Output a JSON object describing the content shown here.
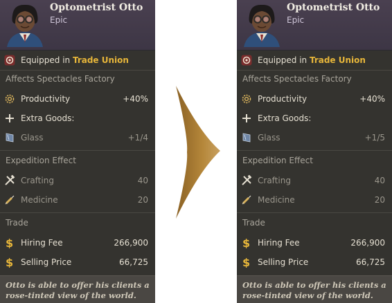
{
  "before": {
    "name": "Optometrist Otto",
    "rarity": "Epic",
    "equipped_prefix": "Equipped in ",
    "equipped_location": "Trade Union",
    "affects": "Affects Spectacles Factory",
    "productivity_label": "Productivity",
    "productivity_value": "+40%",
    "extra_goods_label": "Extra Goods:",
    "glass_label": "Glass",
    "glass_value": "+1/4",
    "expedition_header": "Expedition Effect",
    "crafting_label": "Crafting",
    "crafting_value": "40",
    "medicine_label": "Medicine",
    "medicine_value": "20",
    "trade_header": "Trade",
    "hiring_fee_label": "Hiring Fee",
    "hiring_fee_value": "266,900",
    "selling_price_label": "Selling Price",
    "selling_price_value": "66,725",
    "flavor": "Otto is able to offer his clients a rose-tinted view of the world."
  },
  "after": {
    "name": "Optometrist Otto",
    "rarity": "Epic",
    "equipped_prefix": "Equipped in ",
    "equipped_location": "Trade Union",
    "affects": "Affects Spectacles Factory",
    "productivity_label": "Productivity",
    "productivity_value": "+40%",
    "extra_goods_label": "Extra Goods:",
    "glass_label": "Glass",
    "glass_value": "+1/5",
    "expedition_header": "Expedition Effect",
    "crafting_label": "Crafting",
    "crafting_value": "40",
    "medicine_label": "Medicine",
    "medicine_value": "20",
    "trade_header": "Trade",
    "hiring_fee_label": "Hiring Fee",
    "hiring_fee_value": "266,900",
    "selling_price_label": "Selling Price",
    "selling_price_value": "66,725",
    "flavor": "Otto is able to offer his clients a rose-tinted view of the world."
  },
  "icons": {
    "portrait": "specialist-portrait-icon",
    "location": "trade-union-badge-icon",
    "productivity": "gear-icon",
    "extra_goods": "plus-icon",
    "glass": "glass-pane-icon",
    "crafting": "crossed-tools-icon",
    "medicine": "syringe-icon",
    "hiring_fee": "dollar-icon",
    "selling_price": "dollar-icon",
    "transition_arrow": "right-arrow-icon"
  },
  "colors": {
    "card_bg": "#34332f",
    "header_bg": "#4a4050",
    "accent_gold": "#e7b63a",
    "arrow": "#b5873a"
  }
}
